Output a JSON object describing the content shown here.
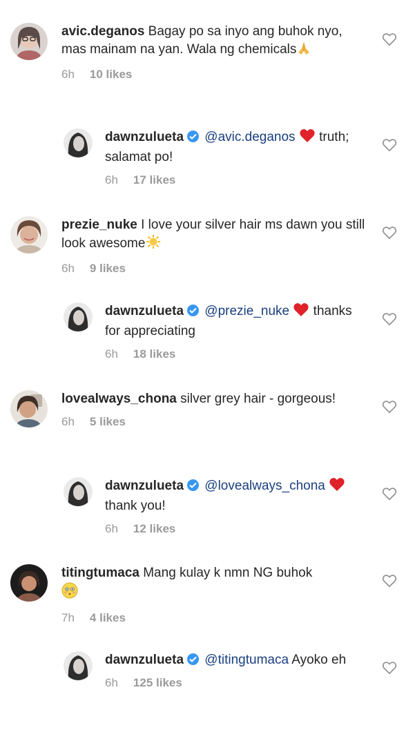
{
  "comments": [
    {
      "username": "avic.deganos",
      "text": "Bagay po sa inyo ang buhok nyo, mas mainam na yan. Wala ng chemicals",
      "time": "6h",
      "likes": "10 likes"
    },
    {
      "username": "dawnzulueta",
      "mention": "@avic.deganos",
      "text": "truth; salamat po!",
      "time": "6h",
      "likes": "17 likes"
    },
    {
      "username": "prezie_nuke",
      "text": "I love your silver hair ms dawn you still look awesome",
      "time": "6h",
      "likes": "9 likes"
    },
    {
      "username": "dawnzulueta",
      "mention": "@prezie_nuke",
      "text": "thanks for appreciating",
      "time": "6h",
      "likes": "18 likes"
    },
    {
      "username": "lovealways_chona",
      "text": "silver grey hair - gorgeous!",
      "time": "6h",
      "likes": "5 likes"
    },
    {
      "username": "dawnzulueta",
      "mention": "@lovealways_chona",
      "text": "thank you!",
      "time": "6h",
      "likes": "12 likes"
    },
    {
      "username": "titingtumaca",
      "text": "Mang kulay k nmn NG buhok",
      "time": "7h",
      "likes": "4 likes"
    },
    {
      "username": "dawnzulueta",
      "mention": "@titingtumaca",
      "text": "Ayoko eh",
      "time": "6h",
      "likes": "125 likes"
    }
  ],
  "colors": {
    "verified": "#3897f0",
    "mention": "#1a3f80",
    "heart_red": "#ed4956",
    "meta": "#9a9a9a"
  },
  "icons": {
    "like": "heart-outline-icon",
    "verified": "verified-badge-icon"
  }
}
